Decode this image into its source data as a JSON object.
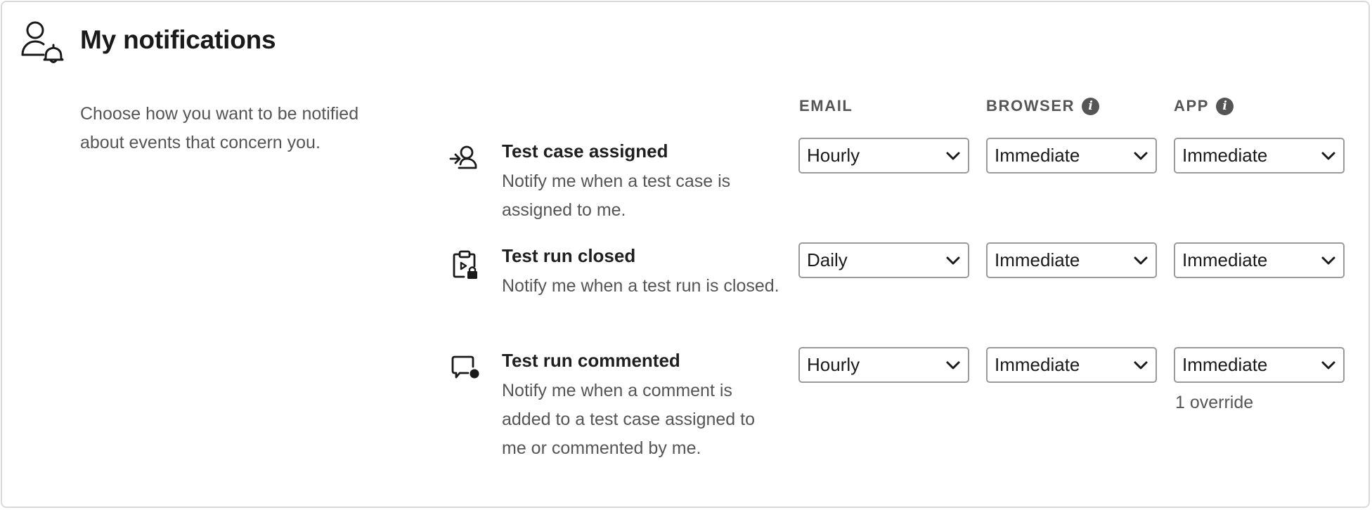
{
  "header": {
    "title": "My notifications",
    "icon": "user-bell-icon"
  },
  "intro": "Choose how you want to be notified about events that concern you.",
  "columns": [
    {
      "label": "EMAIL",
      "info_icon": false
    },
    {
      "label": "BROWSER",
      "info_icon": true
    },
    {
      "label": "APP",
      "info_icon": true
    }
  ],
  "rows": [
    {
      "icon": "assign-user-icon",
      "title": "Test case assigned",
      "description": "Notify me when a test case is assigned to me.",
      "email": "Hourly",
      "browser": "Immediate",
      "app": "Immediate",
      "note": ""
    },
    {
      "icon": "clipboard-lock-icon",
      "title": "Test run closed",
      "description": "Notify me when a test run is closed.",
      "email": "Daily",
      "browser": "Immediate",
      "app": "Immediate",
      "note": ""
    },
    {
      "icon": "comment-dot-icon",
      "title": "Test run commented",
      "description": "Notify me when a comment is added to a test case assigned to me or commented by me.",
      "email": "Hourly",
      "browser": "Immediate",
      "app": "Immediate",
      "note": "1 override"
    }
  ],
  "colors": {
    "text": "#1f1f1f",
    "muted": "#555555",
    "border": "#d9d9d9",
    "select_border": "#9a9a9a"
  }
}
